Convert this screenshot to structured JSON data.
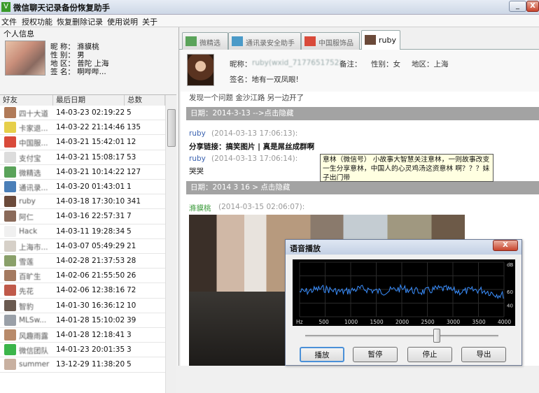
{
  "window": {
    "title": "微信聊天记录备份恢复助手",
    "app_icon": "V",
    "min": "_",
    "close": "X"
  },
  "menu": [
    "文件",
    "授权功能",
    "恢复删除记录",
    "使用说明",
    "关于"
  ],
  "profile": {
    "group_label": "个人信息",
    "nickname": "昵 称：  滌貘桃",
    "gender": "性 别：  男",
    "region": "地 区：  普陀 上海",
    "signature": "签 名：  啊哔哔..."
  },
  "friends": {
    "headers": [
      "好友",
      "最后日期",
      "总数"
    ],
    "rows": [
      {
        "name": "四十大道",
        "date": "14-03-23 02:19:22",
        "count": "5",
        "color": "#b07a58"
      },
      {
        "name": "卡家退...",
        "date": "14-03-22 21:14:46",
        "count": "135",
        "color": "#e6cf4a"
      },
      {
        "name": "中国服...",
        "date": "14-03-21 15:42:01",
        "count": "12",
        "color": "#d94a3a"
      },
      {
        "name": "支付宝",
        "date": "14-03-21 15:08:17",
        "count": "53",
        "color": "#dcdcdc"
      },
      {
        "name": "微精选",
        "date": "14-03-21 10:14:22",
        "count": "127",
        "color": "#5aa35a"
      },
      {
        "name": "通讯录...",
        "date": "14-03-20 01:43:01",
        "count": "1",
        "color": "#4a7fb8"
      },
      {
        "name": "ruby",
        "date": "14-03-18 17:30:10",
        "count": "341",
        "color": "#6b4a3a"
      },
      {
        "name": "阿仁",
        "date": "14-03-16 22:57:31",
        "count": "7",
        "color": "#8a6a5a"
      },
      {
        "name": "Hack",
        "date": "14-03-11 19:28:34",
        "count": "5",
        "color": "#f0f0f0"
      },
      {
        "name": "上海市...",
        "date": "14-03-07 05:49:29",
        "count": "21",
        "color": "#d6d0c8"
      },
      {
        "name": "雪莲",
        "date": "14-02-28 21:37:53",
        "count": "28",
        "color": "#8aa06a"
      },
      {
        "name": "百旷生",
        "date": "14-02-06 21:55:50",
        "count": "26",
        "color": "#a47a60"
      },
      {
        "name": "先花",
        "date": "14-02-06 12:38:16",
        "count": "72",
        "color": "#c05a4a"
      },
      {
        "name": "智豹",
        "date": "14-01-30 16:36:12",
        "count": "10",
        "color": "#6a5a50"
      },
      {
        "name": "MLSw...",
        "date": "14-01-28 15:10:02",
        "count": "39",
        "color": "#9aa0a8"
      },
      {
        "name": "风趣雨露",
        "date": "14-01-28 12:18:41",
        "count": "3",
        "color": "#b88a6a"
      },
      {
        "name": "微信团队",
        "date": "14-01-23 20:01:35",
        "count": "3",
        "color": "#3bb54a"
      },
      {
        "name": "summer",
        "date": "13-12-29 11:38:20",
        "count": "5",
        "color": "#c8b0a0"
      }
    ]
  },
  "tabs": [
    {
      "label": "微精选",
      "color": "#5aa35a"
    },
    {
      "label": "通讯录安全助手",
      "color": "#4a9ac8"
    },
    {
      "label": "中国服饰品",
      "color": "#d94a3a"
    },
    {
      "label": "ruby",
      "color": "#6b4a3a",
      "active": true
    }
  ],
  "contact": {
    "nickname_label": "昵称：",
    "nickname_value": "ruby(wxid_7177651752)",
    "note_label": "备注：",
    "gender": "性别：女",
    "region": "地区：上海",
    "signature": "签名：地有一双凤眼!"
  },
  "chat": {
    "top_cut": "发现一个问题 金沙江路 另一边开了",
    "date1": "日期：2014-3-13  -->点击隐藏",
    "msg1_sender": "ruby",
    "msg1_time": "(2014-03-13 17:06:13):",
    "msg1_text": "分享链接：搞笑图片 | 真是屌丝成群啊",
    "msg2_sender": "ruby",
    "msg2_time": "(2014-03-13 17:06:14):",
    "msg2_text": "哭哭",
    "date2": "日期：2014  3  16     > 点击隐藏",
    "msg3_sender": "滌貘桃",
    "msg3_time": "(2014-03-15 02:06:07):",
    "tooltip": "意林（微信号）  小故事大智慧关注意林，一则故事改变一生分享意林，中国人的心灵鸡汤这资意林 啊？？？妹子出门带"
  },
  "player": {
    "title": "语音播放",
    "close": "X",
    "freq_labels": [
      "Hz",
      "500",
      "1000",
      "1500",
      "2000",
      "2500",
      "3000",
      "3500",
      "4000"
    ],
    "db_labels": [
      "dB",
      "",
      "60",
      "40"
    ],
    "buttons": [
      "播放",
      "暂停",
      "停止",
      "导出"
    ],
    "slider_position": 0.68,
    "signal_color": "#3a8fff",
    "grid_color": "#2a2a2a"
  }
}
